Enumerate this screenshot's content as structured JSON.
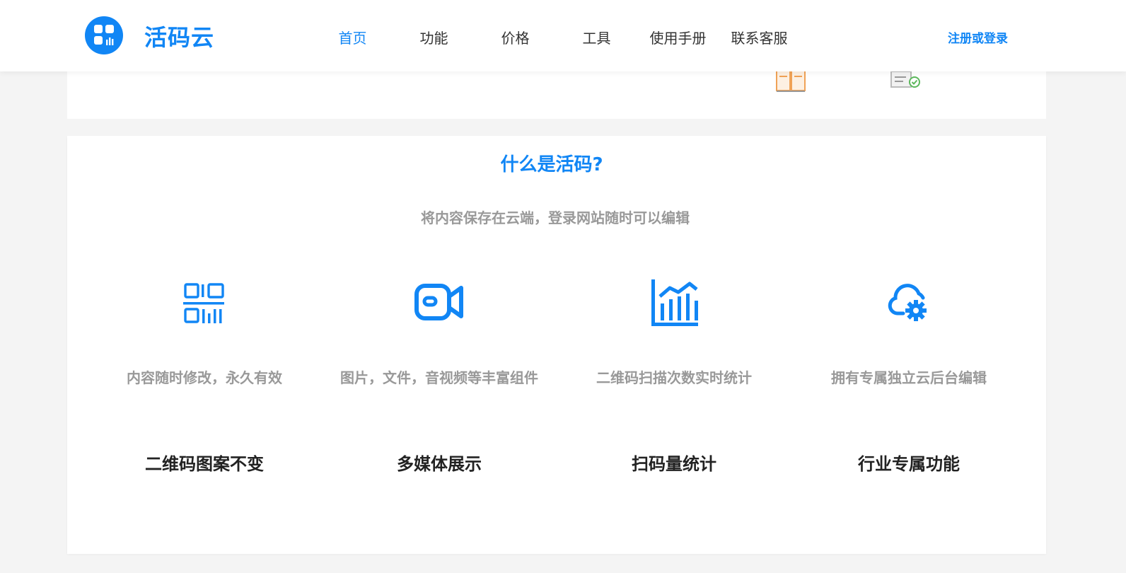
{
  "header": {
    "brand": "活码云",
    "nav": [
      {
        "label": "首页",
        "active": true
      },
      {
        "label": "功能",
        "active": false
      },
      {
        "label": "价格",
        "active": false
      },
      {
        "label": "工具",
        "active": false
      },
      {
        "label": "使用手册",
        "active": false
      },
      {
        "label": "联系客服",
        "active": false
      }
    ],
    "login_label": "注册或登录"
  },
  "section": {
    "title": "什么是活码?",
    "subtitle": "将内容保存在云端，登录网站随时可以编辑"
  },
  "features": [
    {
      "icon": "qr-code-icon",
      "description": "内容随时修改，永久有效",
      "title": "二维码图案不变"
    },
    {
      "icon": "video-camera-icon",
      "description": "图片，文件，音视频等丰富组件",
      "title": "多媒体展示"
    },
    {
      "icon": "bar-chart-icon",
      "description": "二维码扫描次数实时统计",
      "title": "扫码量统计"
    },
    {
      "icon": "cloud-settings-icon",
      "description": "拥有专属独立云后台编辑",
      "title": "行业专属功能"
    }
  ],
  "colors": {
    "accent": "#1186f5",
    "muted": "#999999",
    "heading": "#222222"
  }
}
